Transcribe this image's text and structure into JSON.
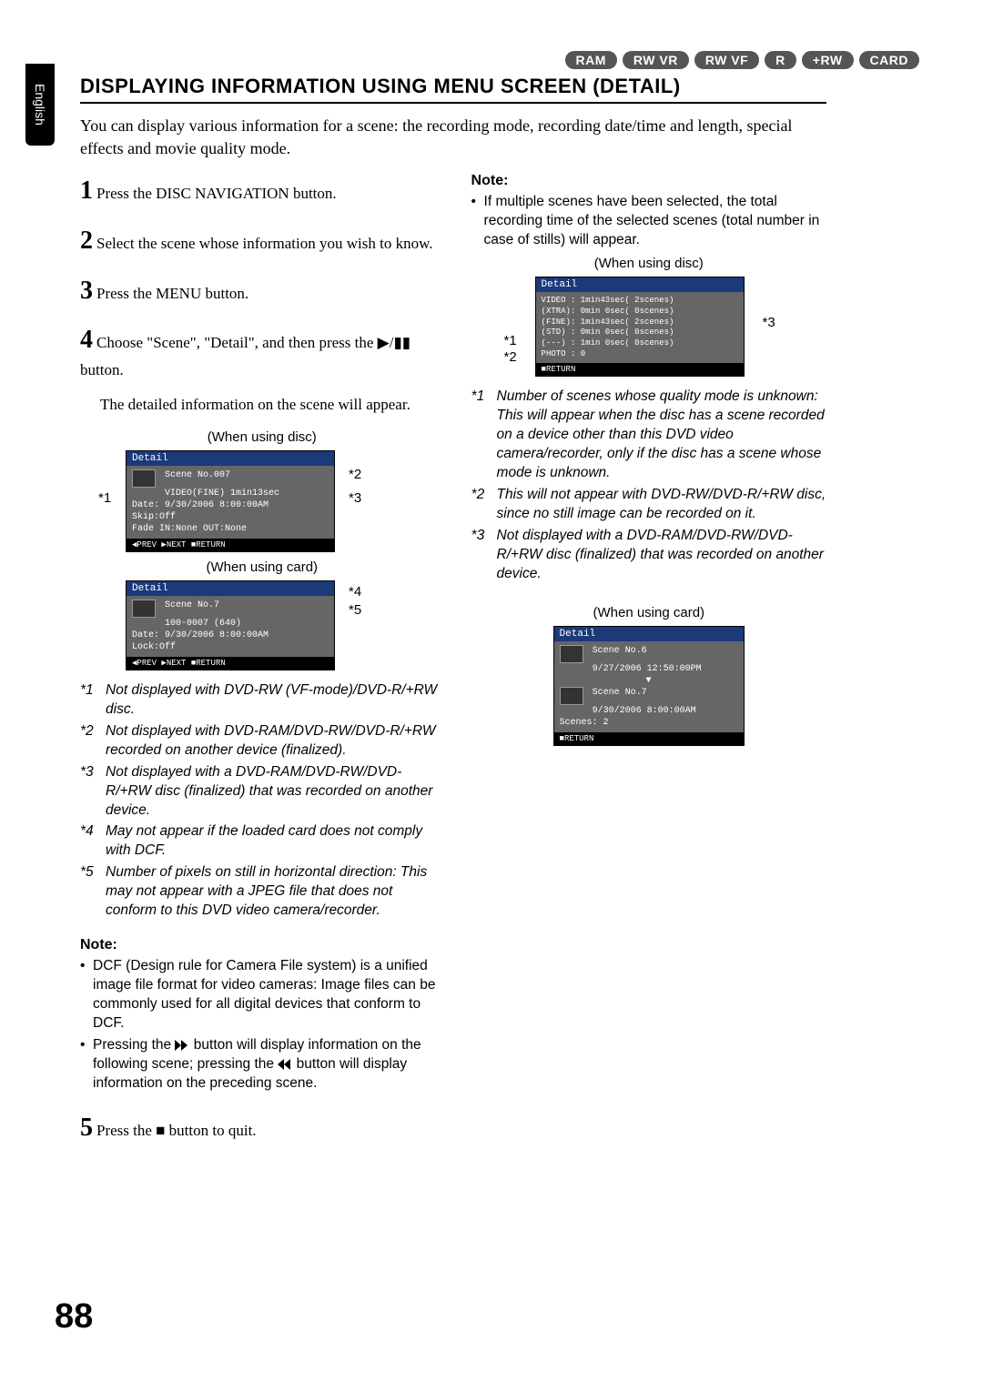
{
  "lang": "English",
  "badges": [
    "RAM",
    "RW VR",
    "RW VF",
    "R",
    "+RW",
    "CARD"
  ],
  "title": "DISPLAYING INFORMATION USING MENU SCREEN (DETAIL)",
  "intro": "You can display various information for a scene: the recording mode, recording date/time and length, special effects and movie quality mode.",
  "steps": {
    "s1": "Press the DISC NAVIGATION button.",
    "s2": "Select the scene whose information you wish to know.",
    "s3": "Press the MENU button.",
    "s4": "Choose \"Scene\", \"Detail\", and then press the ▶/▮▮ button.",
    "s4b": "The detailed information on the scene will appear.",
    "s5": "Press the ■ button to quit."
  },
  "captions": {
    "disc": "(When using disc)",
    "card": "(When using card)"
  },
  "panelDiscSingle": {
    "header": "Detail",
    "l1a": "Scene No.007",
    "l1b": "VIDEO(FINE)  1min13sec",
    "l2": "Date: 9/30/2006   8:00:00AM",
    "l3": "Skip:Off",
    "l4": "Fade IN:None OUT:None",
    "footer": "◀PREV  ▶NEXT  ■RETURN"
  },
  "panelCardSingle": {
    "header": "Detail",
    "l1": "Scene No.7",
    "l2": "100-0007 (640)",
    "l3": "Date: 9/30/2006   8:00:00AM",
    "l4": "Lock:Off",
    "footer": "◀PREV  ▶NEXT  ■RETURN"
  },
  "leftNotes": {
    "n1": "Not displayed with DVD-RW (VF-mode)/DVD-R/+RW disc.",
    "n2": "Not displayed with DVD-RAM/DVD-RW/DVD-R/+RW recorded on another device (finalized).",
    "n3": "Not displayed with a DVD-RAM/DVD-RW/DVD-R/+RW disc (finalized) that was recorded on another device.",
    "n4": "May not appear if the loaded card does not comply with DCF.",
    "n5": "Number of pixels on still in horizontal direction: This may not appear with a JPEG file that does not conform to this DVD video camera/recorder."
  },
  "leftNote2": {
    "b1": "DCF (Design rule for Camera File system) is a unified image file format for video cameras: Image files can be commonly used for all digital devices that conform to DCF.",
    "b2a": "Pressing the ",
    "b2b": " button will display information on the following scene; pressing the ",
    "b2c": " button will display information on the preceding scene."
  },
  "rightNote": {
    "hdr": "Note:",
    "b1": "If multiple scenes have been selected, the total recording time of the selected scenes (total number in case of stills) will appear."
  },
  "panelDiscMulti": {
    "header": "Detail",
    "l1": "VIDEO : 1min43sec(  2scenes)",
    "l2": "(XTRA): 0min 0sec(  0scenes)",
    "l3": "(FINE): 1min43sec(  2scenes)",
    "l4": "(STD) : 0min 0sec(  0scenes)",
    "l5": "(---) : 1min 0sec(  0scenes)",
    "l6": "PHOTO : 0",
    "footer": "■RETURN"
  },
  "rightNotes": {
    "n1a": "Number of scenes whose quality mode is unknown:",
    "n1b": "This will appear when the disc has a scene recorded on a device other than this DVD video camera/recorder, only if the disc has a scene whose mode is unknown.",
    "n2": "This will not appear with DVD-RW/DVD-R/+RW disc, since no still image can be recorded on it.",
    "n3": "Not displayed with a DVD-RAM/DVD-RW/DVD-R/+RW disc (finalized) that was recorded on another device."
  },
  "panelCardMulti": {
    "header": "Detail",
    "l1": "Scene No.6",
    "l2": "9/27/2006 12:50:00PM",
    "l3": "Scene No.7",
    "l4": "9/30/2006  8:00:00AM",
    "l5": "Scenes: 2",
    "footer": "■RETURN"
  },
  "labels": {
    "a1": "*1",
    "a2": "*2",
    "a3": "*3",
    "a4": "*4",
    "a5": "*5"
  },
  "page": "88"
}
